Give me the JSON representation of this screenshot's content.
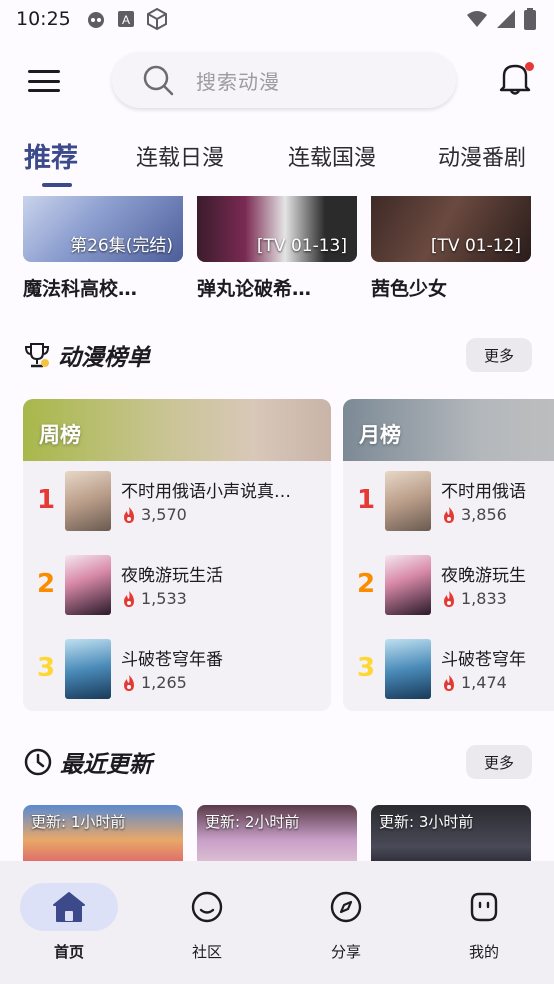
{
  "status_bar": {
    "time": "10:25"
  },
  "search": {
    "placeholder": "搜索动漫"
  },
  "tabs": [
    {
      "label": "推荐"
    },
    {
      "label": "连载日漫"
    },
    {
      "label": "连载国漫"
    },
    {
      "label": "动漫番剧"
    }
  ],
  "top_cards": [
    {
      "episode": "第26集(完结)",
      "title": "魔法科高校…"
    },
    {
      "episode": "[TV 01-13]",
      "title": "弹丸论破希…"
    },
    {
      "episode": "[TV 01-12]",
      "title": "茜色少女"
    }
  ],
  "rank_section": {
    "title": "动漫榜单",
    "more_label": "更多",
    "lists": [
      {
        "name": "周榜",
        "items": [
          {
            "rank": "1",
            "title": "不时用俄语小声说真…",
            "heat": "3,570"
          },
          {
            "rank": "2",
            "title": "夜晚游玩生活",
            "heat": "1,533"
          },
          {
            "rank": "3",
            "title": "斗破苍穹年番",
            "heat": "1,265"
          }
        ]
      },
      {
        "name": "月榜",
        "items": [
          {
            "rank": "1",
            "title": "不时用俄语",
            "heat": "3,856"
          },
          {
            "rank": "2",
            "title": "夜晚游玩生",
            "heat": "1,833"
          },
          {
            "rank": "3",
            "title": "斗破苍穹年",
            "heat": "1,474"
          }
        ]
      }
    ]
  },
  "recent_section": {
    "title": "最近更新",
    "more_label": "更多",
    "cards": [
      {
        "update": "更新: 1小时前"
      },
      {
        "update": "更新: 2小时前"
      },
      {
        "update": "更新: 3小时前"
      }
    ]
  },
  "bottom_nav": [
    {
      "label": "首页",
      "icon": "home-icon"
    },
    {
      "label": "社区",
      "icon": "smile-icon"
    },
    {
      "label": "分享",
      "icon": "compass-icon"
    },
    {
      "label": "我的",
      "icon": "face-icon"
    }
  ],
  "colors": {
    "accent": "#3c4a8c",
    "rank1": "#e53935",
    "rank2": "#fb8c00",
    "rank3": "#fdd835",
    "heat": "#e53935"
  }
}
